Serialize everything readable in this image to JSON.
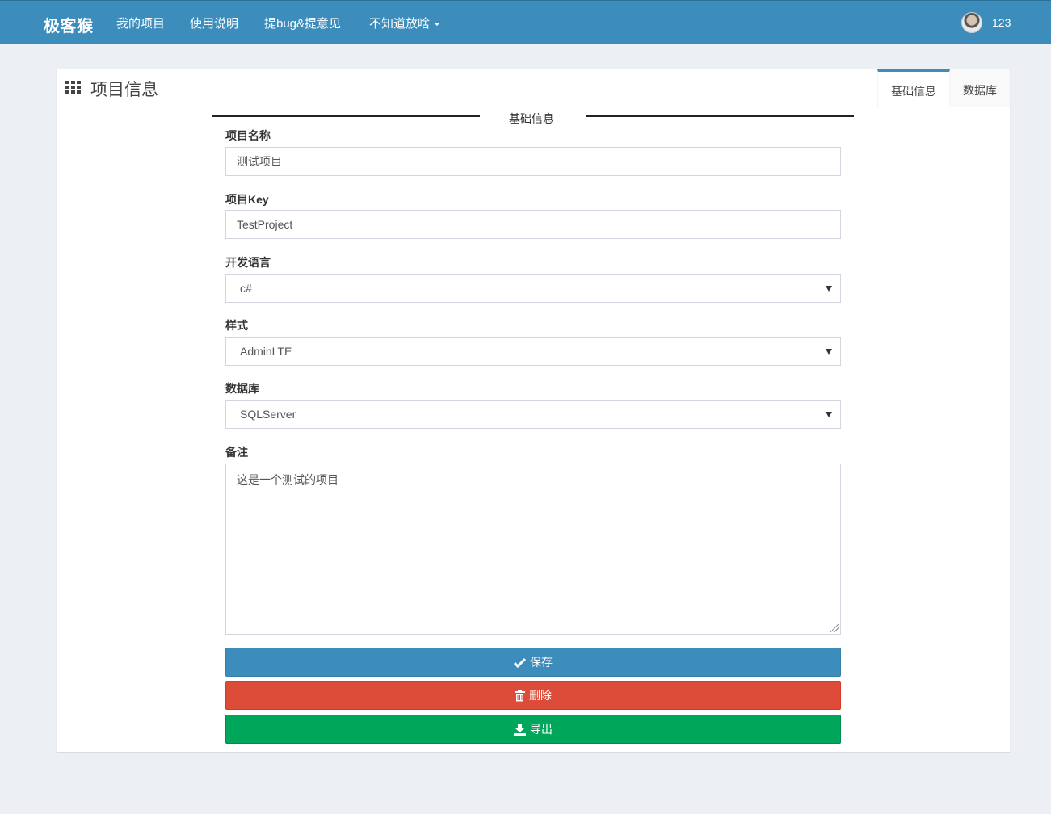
{
  "navbar": {
    "brand": "极客猴",
    "items": [
      "我的项目",
      "使用说明",
      "提bug&提意见",
      "不知道放啥"
    ],
    "user": "123"
  },
  "box": {
    "title": "项目信息",
    "tabs": [
      "基础信息",
      "数据库"
    ],
    "legend": "基础信息"
  },
  "form": {
    "name_label": "项目名称",
    "name_value": "测试项目",
    "key_label": "项目Key",
    "key_value": "TestProject",
    "lang_label": "开发语言",
    "lang_value": "c#",
    "style_label": "样式",
    "style_value": "AdminLTE",
    "db_label": "数据库",
    "db_value": "SQLServer",
    "remark_label": "备注",
    "remark_value": "这是一个测试的项目"
  },
  "buttons": {
    "save": "保存",
    "delete": "删除",
    "export": "导出"
  },
  "colors": {
    "primary": "#3c8dbc",
    "danger": "#dd4b39",
    "success": "#00a65a",
    "background": "#ecf0f5"
  }
}
